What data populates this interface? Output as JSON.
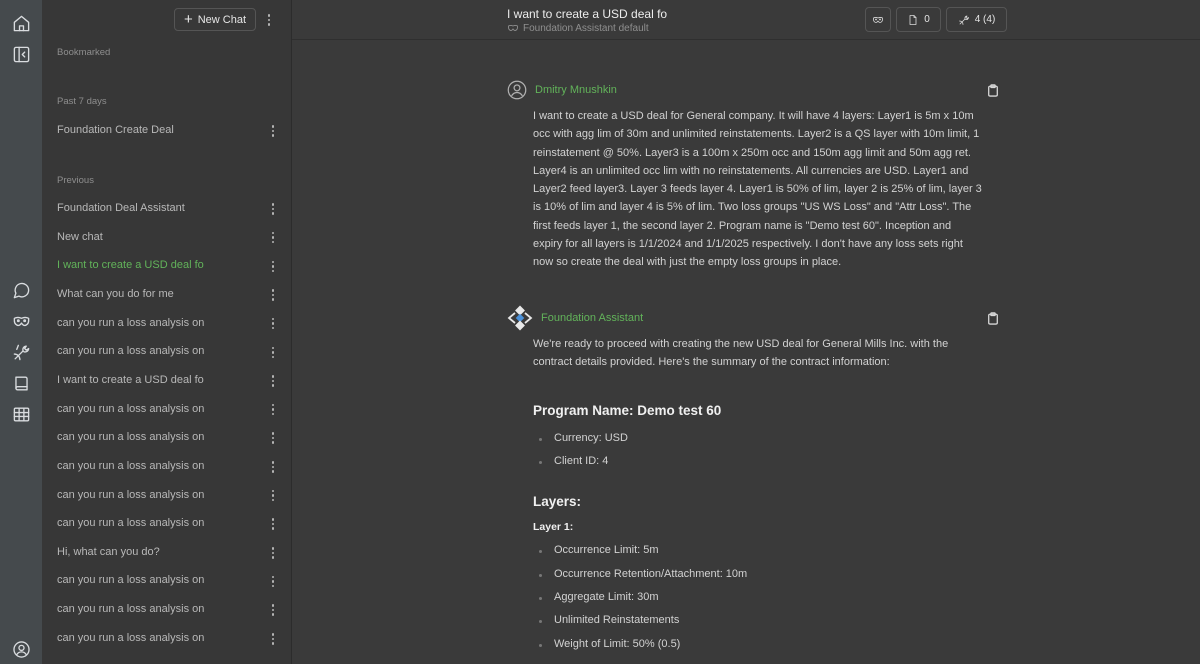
{
  "rail": {
    "icons": [
      "home-icon",
      "sidebar-collapse-icon",
      "chat-icon",
      "mask-icon",
      "tools-icon",
      "book-icon",
      "table-icon",
      "user-circle-icon"
    ]
  },
  "sidebar": {
    "new_chat_label": "New Chat",
    "sections": {
      "bookmarked": "Bookmarked",
      "past7": "Past 7 days",
      "previous": "Previous"
    },
    "past7_items": [
      {
        "label": "Foundation Create Deal"
      }
    ],
    "previous_items": [
      {
        "label": "Foundation Deal Assistant"
      },
      {
        "label": "New chat"
      },
      {
        "label": "I want to create a USD deal fo",
        "active": true
      },
      {
        "label": "What can you do for me"
      },
      {
        "label": "can you run a loss analysis on"
      },
      {
        "label": "can you run a loss analysis on"
      },
      {
        "label": "I want to create a USD deal fo"
      },
      {
        "label": "can you run a loss analysis on"
      },
      {
        "label": "can you run a loss analysis on"
      },
      {
        "label": "can you run a loss analysis on"
      },
      {
        "label": "can you run a loss analysis on"
      },
      {
        "label": "can you run a loss analysis on"
      },
      {
        "label": "Hi, what can you do?"
      },
      {
        "label": "can you run a loss analysis on"
      },
      {
        "label": "can you run a loss analysis on"
      },
      {
        "label": "can you run a loss analysis on"
      }
    ]
  },
  "header": {
    "title": "I want to create a USD deal fo",
    "subtitle": "Foundation Assistant default",
    "files_count": "0",
    "tools_count": "4 (4)"
  },
  "messages": {
    "user": {
      "author": "Dmitry Mnushkin",
      "text": "I want to create a USD deal for General company. It will have 4 layers: Layer1 is 5m x 10m occ with agg lim of 30m and unlimited reinstatements. Layer2 is a QS layer with 10m limit, 1 reinstatement @ 50%. Layer3 is a 100m x 250m occ and 150m agg limit and 50m agg ret. Layer4 is an unlimited occ lim with no reinstatements. All currencies are USD. Layer1 and Layer2 feed layer3. Layer 3 feeds layer 4. Layer1 is 50% of lim, layer 2 is 25% of lim, layer 3 is 10% of lim and layer 4 is 5% of lim. Two loss groups \"US WS Loss\" and \"Attr Loss\". The first feeds layer 1, the second layer 2. Program name is \"Demo test 60\". Inception and expiry for all layers is 1/1/2024 and 1/1/2025 respectively. I don't have any loss sets right now so create the deal with just the empty loss groups in place."
    },
    "assistant": {
      "author": "Foundation Assistant",
      "intro": "We're ready to proceed with creating the new USD deal for General Mills Inc. with the contract details provided. Here's the summary of the contract information:",
      "program_heading": "Program Name: Demo test 60",
      "program_bullets": [
        "Currency: USD",
        "Client ID: 4"
      ],
      "layers_heading": "Layers:",
      "layer1_heading": "Layer 1:",
      "layer1_bullets": [
        "Occurrence Limit: 5m",
        "Occurrence Retention/Attachment: 10m",
        "Aggregate Limit: 30m",
        "Unlimited Reinstatements",
        "Weight of Limit: 50% (0.5)"
      ]
    }
  }
}
